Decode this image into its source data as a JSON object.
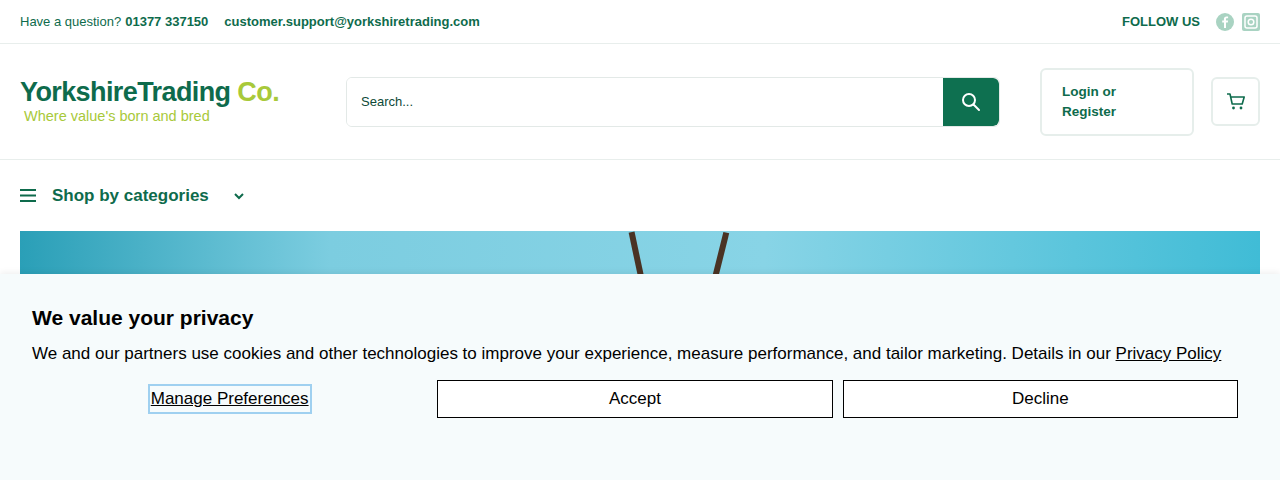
{
  "top_bar": {
    "question": "Have a question?",
    "phone": "01377 337150",
    "email": "customer.support@yorkshiretrading.com",
    "follow": "FOLLOW US"
  },
  "logo": {
    "name": "YorkshireTrading",
    "suffix": " Co.",
    "tagline": "Where value's born and bred"
  },
  "search": {
    "placeholder": "Search..."
  },
  "account": {
    "label": "Login or Register"
  },
  "categories": {
    "label": "Shop by categories",
    "expanded": false
  },
  "cookie_banner": {
    "title": "We value your privacy",
    "text": "We and our partners use cookies and other technologies to improve your experience, measure performance, and tailor marketing. Details in our ",
    "link": "Privacy Policy",
    "buttons": [
      {
        "label": "Manage Preferences",
        "kind": "link"
      },
      {
        "label": "Accept",
        "kind": "outline"
      },
      {
        "label": "Decline",
        "kind": "outline"
      }
    ]
  }
}
